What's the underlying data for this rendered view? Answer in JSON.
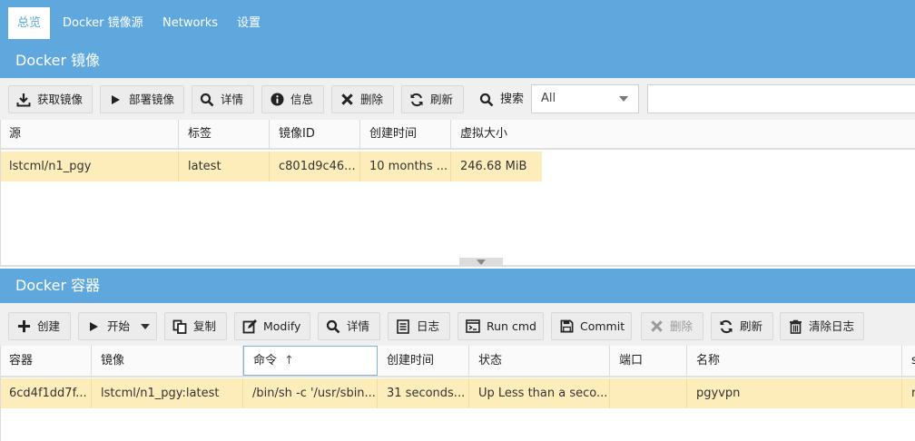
{
  "nav": {
    "tabs": [
      {
        "label": "总览",
        "active": true
      },
      {
        "label": "Docker 镜像源",
        "active": false
      },
      {
        "label": "Networks",
        "active": false
      },
      {
        "label": "设置",
        "active": false
      }
    ]
  },
  "images": {
    "title": "Docker 镜像",
    "toolbar": {
      "pull": "获取镜像",
      "deploy": "部署镜像",
      "details": "详情",
      "info": "信息",
      "delete": "删除",
      "refresh": "刷新",
      "search_label": "搜索",
      "filter_value": "All",
      "search_value": ""
    },
    "columns": [
      "源",
      "标签",
      "镜像ID",
      "创建时间",
      "虚拟大小"
    ],
    "rows": [
      [
        "lstcml/n1_pgy",
        "latest",
        "c801d9c46...",
        "10 months ...",
        "246.68 MiB"
      ]
    ]
  },
  "containers": {
    "title": "Docker 容器",
    "toolbar": {
      "create": "创建",
      "start": "开始",
      "copy": "复制",
      "modify": "Modify",
      "details": "详情",
      "logs": "日志",
      "run_cmd": "Run cmd",
      "commit": "Commit",
      "delete": "删除",
      "refresh": "刷新",
      "clear_logs": "清除日志"
    },
    "columns": [
      "容器",
      "镜像",
      "命令",
      "创建时间",
      "状态",
      "端口",
      "名称",
      "s"
    ],
    "sort_indicator": "↑",
    "rows": [
      [
        "6cd4f1dd7f...",
        "lstcml/n1_pgy:latest",
        "/bin/sh -c '/usr/sbin...",
        "31 seconds...",
        "Up Less than a seco...",
        "",
        "pgyvpn",
        "r"
      ]
    ]
  },
  "colors": {
    "header_blue": "#5fa8de",
    "row_highlight": "#fdedbb",
    "toolbar_bg": "#f0f0f0"
  }
}
